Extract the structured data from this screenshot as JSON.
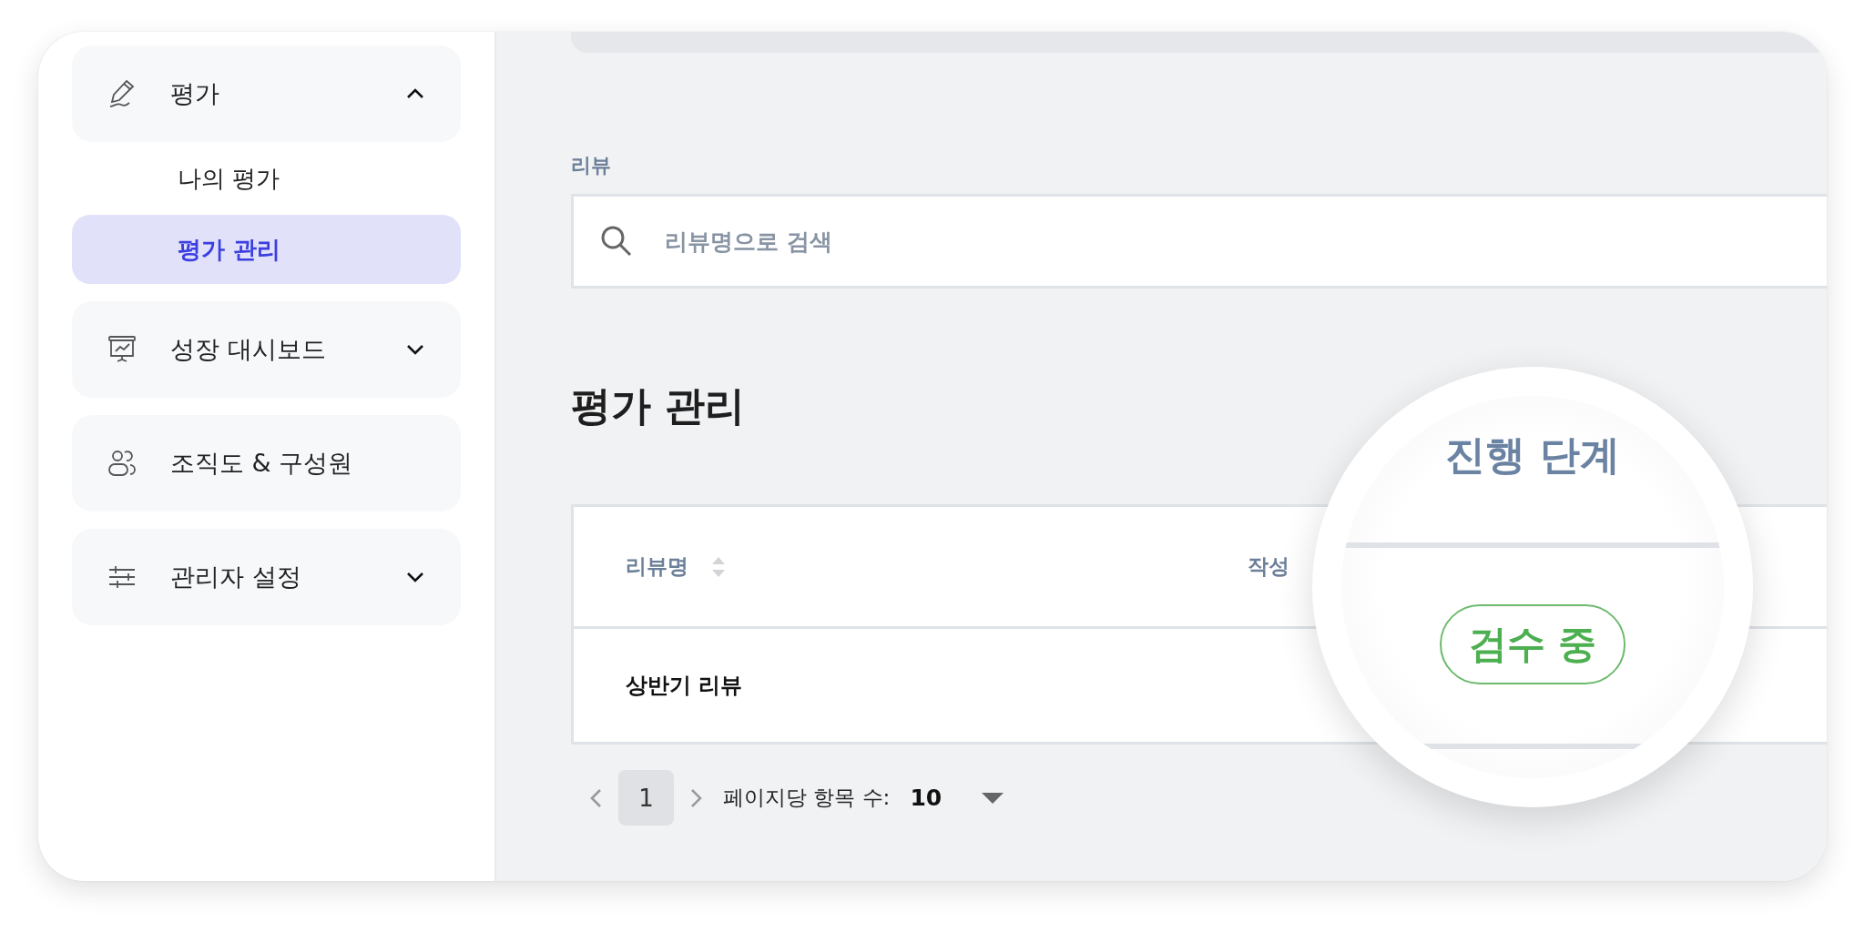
{
  "sidebar": {
    "items": [
      {
        "label": "평가",
        "expandable": true,
        "expanded": true,
        "children": [
          {
            "label": "나의 평가",
            "selected": false
          },
          {
            "label": "평가 관리",
            "selected": true
          }
        ]
      },
      {
        "label": "성장 대시보드",
        "expandable": true,
        "expanded": false
      },
      {
        "label": "조직도 & 구성원",
        "expandable": false,
        "expanded": false
      },
      {
        "label": "관리자 설정",
        "expandable": true,
        "expanded": false
      }
    ]
  },
  "main": {
    "section_label": "리뷰",
    "search": {
      "placeholder": "리뷰명으로 검색"
    },
    "title": "평가 관리",
    "table": {
      "columns": [
        {
          "label": "리뷰명",
          "sortable": true
        },
        {
          "label": "작성",
          "sortable": false
        }
      ],
      "rows": [
        [
          "상반기 리뷰"
        ]
      ]
    },
    "pagination": {
      "pages": [
        {
          "label": "1",
          "selected": true
        }
      ],
      "per_page_label": "페이지당 항목 수:",
      "per_page": "10"
    }
  },
  "magnifier": {
    "column": "진행 단계",
    "badge": "검수 중"
  }
}
